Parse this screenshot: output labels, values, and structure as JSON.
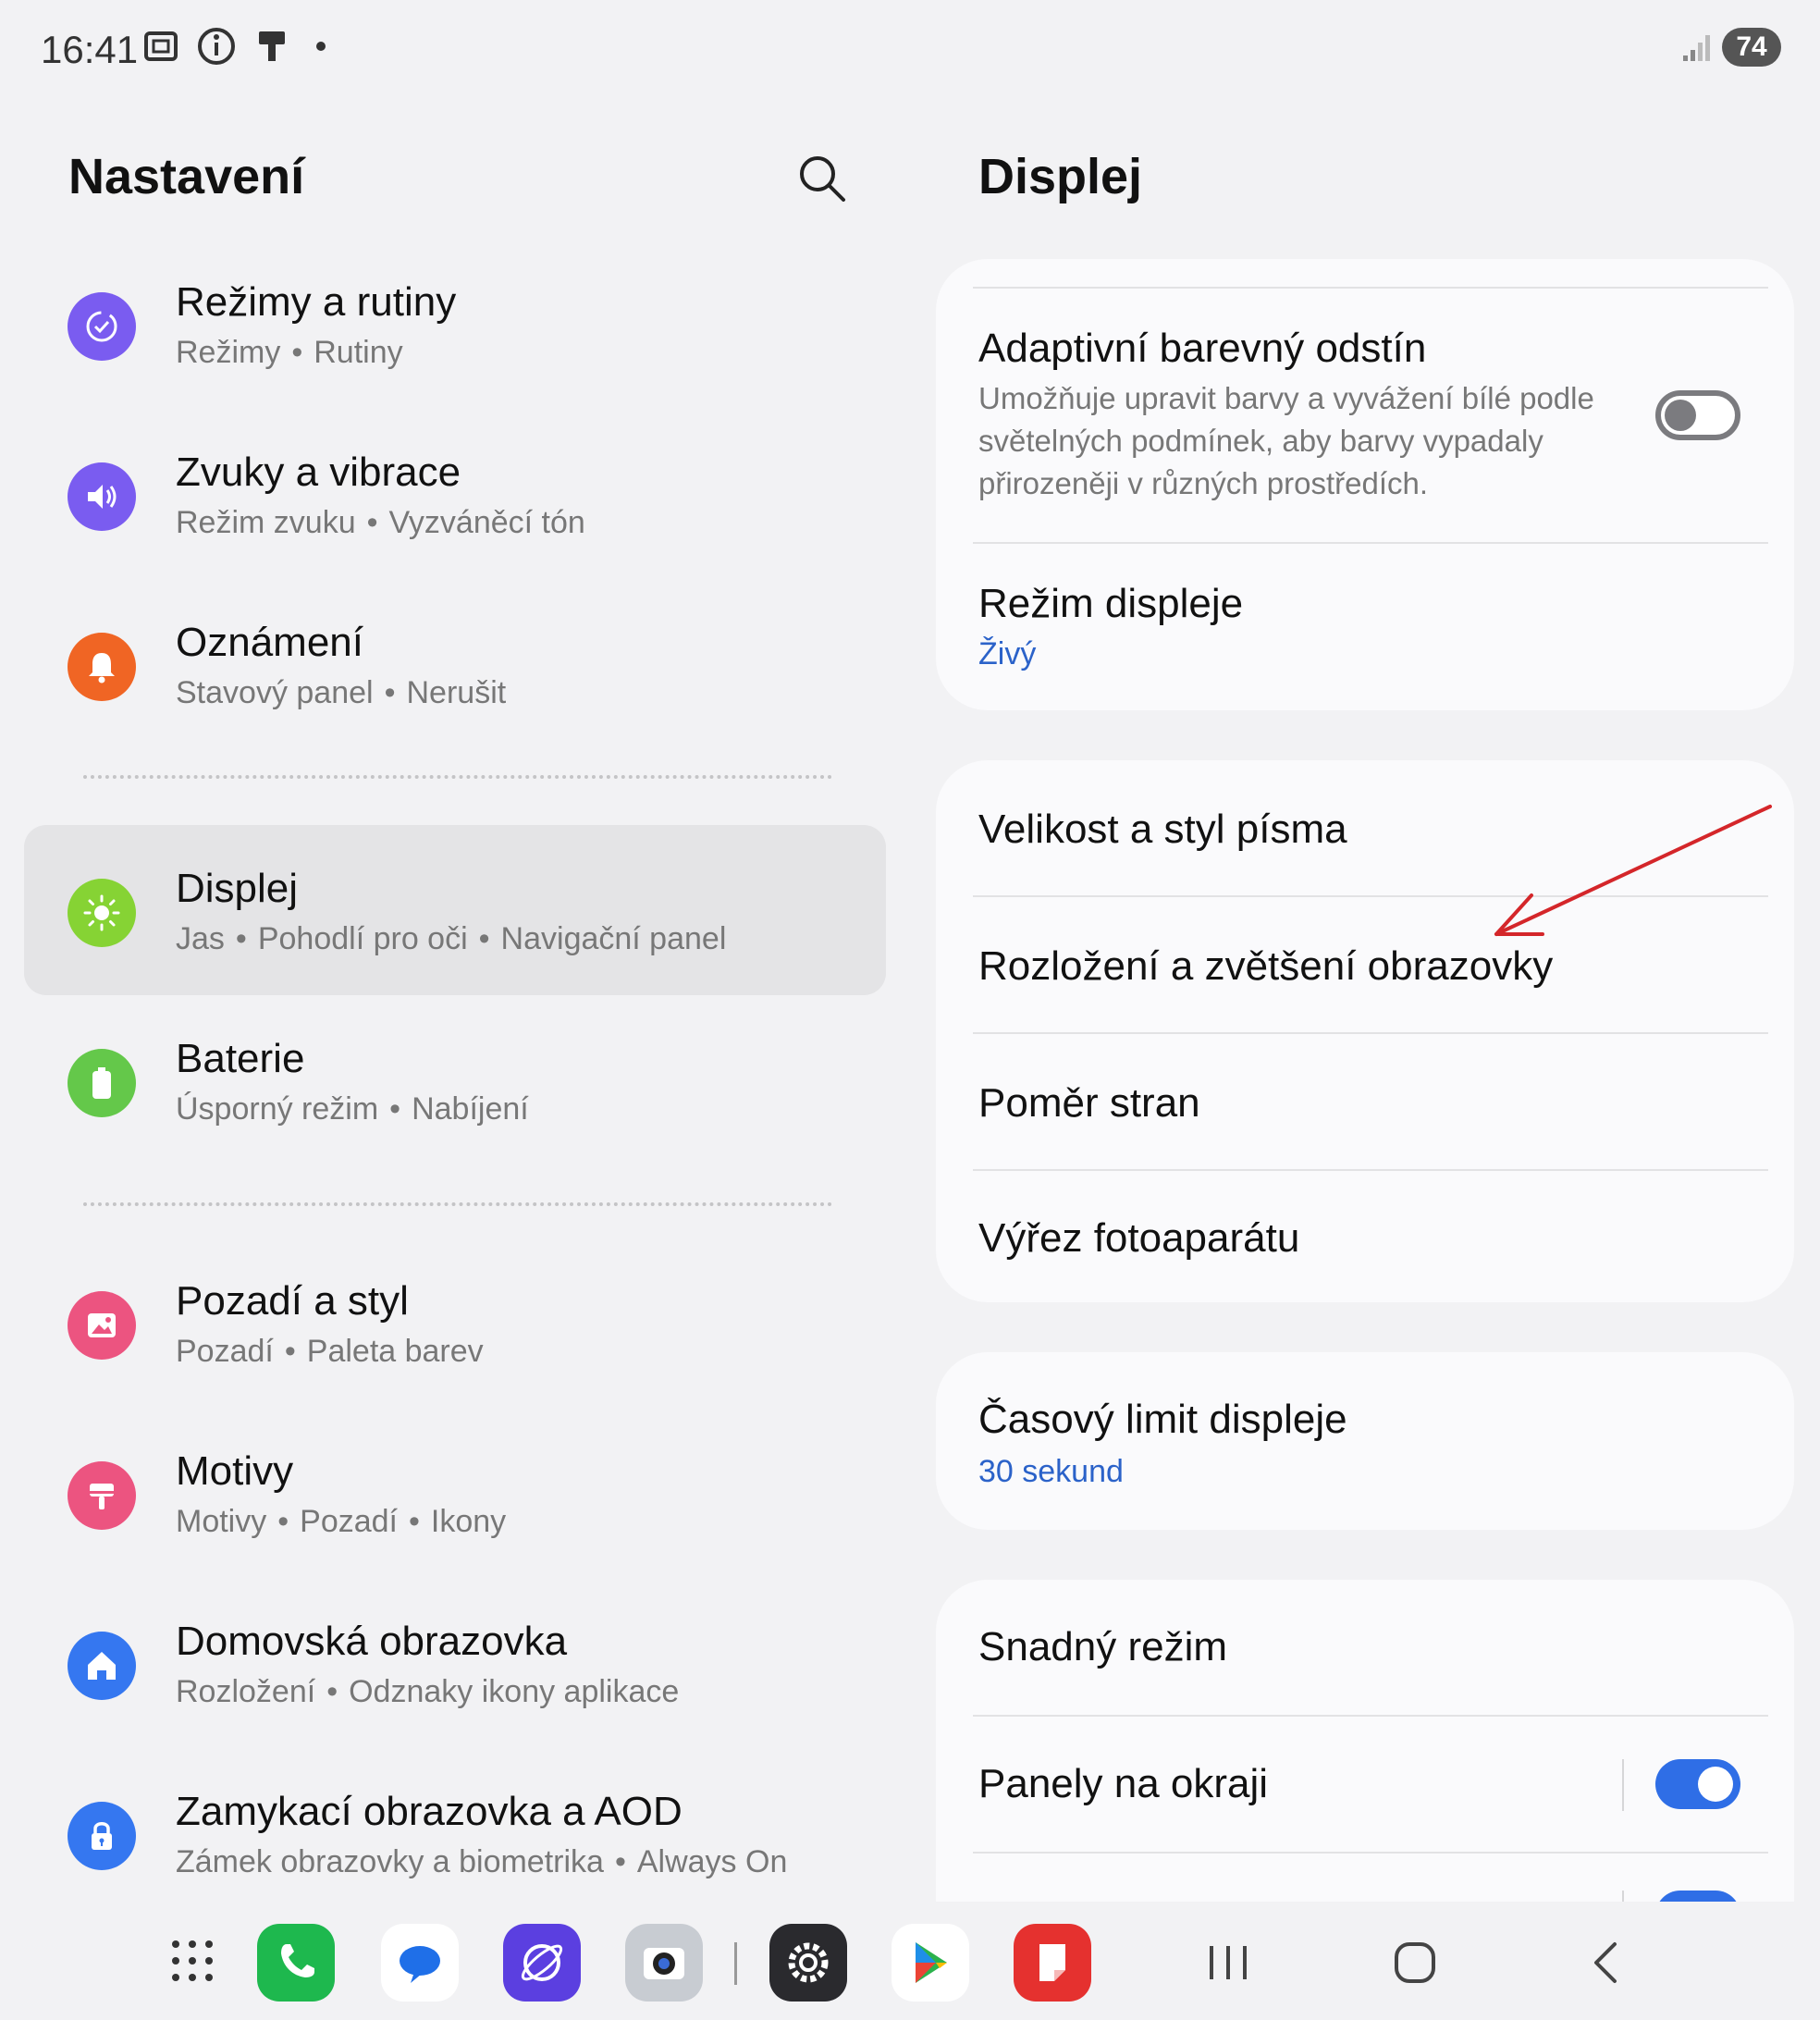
{
  "status_bar": {
    "time": "16:41",
    "battery": "74"
  },
  "left": {
    "title": "Nastavení",
    "items": [
      {
        "title": "Režimy a rutiny",
        "subs": [
          "Režimy",
          "Rutiny"
        ],
        "icon": "modes-icon",
        "color": "#7a5cf0"
      },
      {
        "title": "Zvuky a vibrace",
        "subs": [
          "Režim zvuku",
          "Vyzváněcí tón"
        ],
        "icon": "sound-icon",
        "color": "#7a5cf0"
      },
      {
        "title": "Oznámení",
        "subs": [
          "Stavový panel",
          "Nerušit"
        ],
        "icon": "bell-icon",
        "color": "#f06524"
      },
      {
        "title": "Displej",
        "subs": [
          "Jas",
          "Pohodlí pro oči",
          "Navigační panel"
        ],
        "icon": "sun-icon",
        "color": "#86d334"
      },
      {
        "title": "Baterie",
        "subs": [
          "Úsporný režim",
          "Nabíjení"
        ],
        "icon": "battery-icon",
        "color": "#64c84a"
      },
      {
        "title": "Pozadí a styl",
        "subs": [
          "Pozadí",
          "Paleta barev"
        ],
        "icon": "wallpaper-icon",
        "color": "#ec5480"
      },
      {
        "title": "Motivy",
        "subs": [
          "Motivy",
          "Pozadí",
          "Ikony"
        ],
        "icon": "themes-icon",
        "color": "#ec5480"
      },
      {
        "title": "Domovská obrazovka",
        "subs": [
          "Rozložení",
          "Odznaky ikony aplikace"
        ],
        "icon": "home-icon",
        "color": "#3577f0"
      },
      {
        "title": "Zamykací obrazovka a AOD",
        "subs": [
          "Zámek obrazovky a biometrika",
          "Always On"
        ],
        "icon": "lock-icon",
        "color": "#3577f0"
      }
    ]
  },
  "right": {
    "title": "Displej",
    "adaptive": {
      "title": "Adaptivní barevný odstín",
      "desc": "Umožňuje upravit barvy a vyvážení bílé podle světelných podmínek, aby barvy vypadaly přirozeněji v různých prostředích.",
      "enabled": false
    },
    "display_mode": {
      "title": "Režim displeje",
      "value": "Živý"
    },
    "font_size": "Velikost a styl písma",
    "layout_zoom": "Rozložení a zvětšení obrazovky",
    "aspect_ratio": "Poměr stran",
    "camera_cutout": "Výřez fotoaparátu",
    "timeout": {
      "title": "Časový limit displeje",
      "value": "30 sekund"
    },
    "easy_mode": "Snadný režim",
    "edge_panels": {
      "title": "Panely na okraji",
      "enabled": true
    }
  },
  "dock": {
    "apps": [
      "phone-app-icon",
      "messages-app-icon",
      "internet-app-icon",
      "camera-app-icon",
      "settings-app-icon",
      "play-store-app-icon",
      "notes-app-icon"
    ]
  },
  "colors": {
    "accent": "#2f6ee6",
    "link": "#2b62c9",
    "annotation": "#d4262a"
  }
}
